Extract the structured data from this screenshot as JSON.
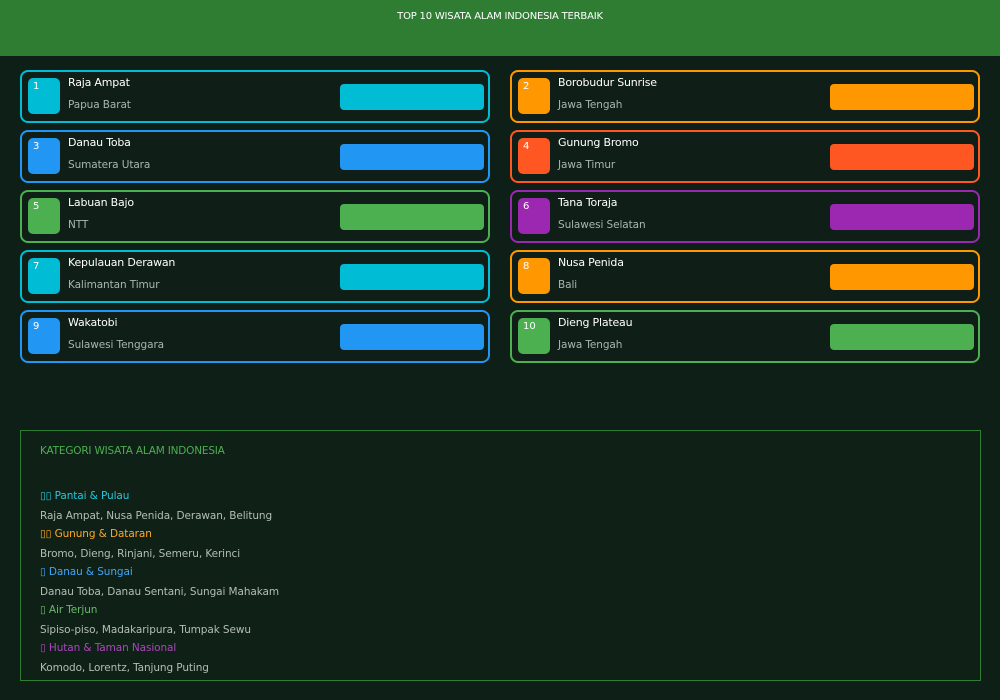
{
  "header": {
    "title": "TOP 10 WISATA ALAM INDONESIA TERBAIK"
  },
  "colors": {
    "header_bg": "#2e7d32",
    "background": "#0d1f16",
    "cyan": "#00bcd4",
    "blue": "#2196f3",
    "green": "#4caf50",
    "orange": "#ff9800",
    "deep_orange": "#ff5722",
    "purple": "#9c27b0"
  },
  "destinations": [
    {
      "rank": "1",
      "name": "Raja Ampat",
      "region": "Papua Barat",
      "color": "#00bcd4"
    },
    {
      "rank": "2",
      "name": "Borobudur Sunrise",
      "region": "Jawa Tengah",
      "color": "#ff9800"
    },
    {
      "rank": "3",
      "name": "Danau Toba",
      "region": "Sumatera Utara",
      "color": "#2196f3"
    },
    {
      "rank": "4",
      "name": "Gunung Bromo",
      "region": "Jawa Timur",
      "color": "#ff5722"
    },
    {
      "rank": "5",
      "name": "Labuan Bajo",
      "region": "NTT",
      "color": "#4caf50"
    },
    {
      "rank": "6",
      "name": "Tana Toraja",
      "region": "Sulawesi Selatan",
      "color": "#9c27b0"
    },
    {
      "rank": "7",
      "name": "Kepulauan Derawan",
      "region": "Kalimantan Timur",
      "color": "#00bcd4"
    },
    {
      "rank": "8",
      "name": "Nusa Penida",
      "region": "Bali",
      "color": "#ff9800"
    },
    {
      "rank": "9",
      "name": "Wakatobi",
      "region": "Sulawesi Tenggara",
      "color": "#2196f3"
    },
    {
      "rank": "10",
      "name": "Dieng Plateau",
      "region": "Jawa Tengah",
      "color": "#4caf50"
    }
  ],
  "categories": {
    "title": "KATEGORI WISATA ALAM INDONESIA",
    "items": [
      {
        "name": "▯▯ Pantai & Pulau",
        "items": "Raja Ampat, Nusa Penida, Derawan, Belitung",
        "color": "#26c6da",
        "icon": "beach-icon"
      },
      {
        "name": "▯▯ Gunung & Dataran",
        "items": "Bromo, Dieng, Rinjani, Semeru, Kerinci",
        "color": "#ffa726",
        "icon": "mountain-icon"
      },
      {
        "name": "▯ Danau & Sungai",
        "items": "Danau Toba, Danau Sentani, Sungai Mahakam",
        "color": "#42a5f5",
        "icon": "lake-icon"
      },
      {
        "name": "▯ Air Terjun",
        "items": "Sipiso-piso, Madakaripura, Tumpak Sewu",
        "color": "#66bb6a",
        "icon": "waterfall-icon"
      },
      {
        "name": "▯ Hutan & Taman Nasional",
        "items": "Komodo, Lorentz, Tanjung Puting",
        "color": "#ab47bc",
        "icon": "forest-icon"
      }
    ]
  }
}
